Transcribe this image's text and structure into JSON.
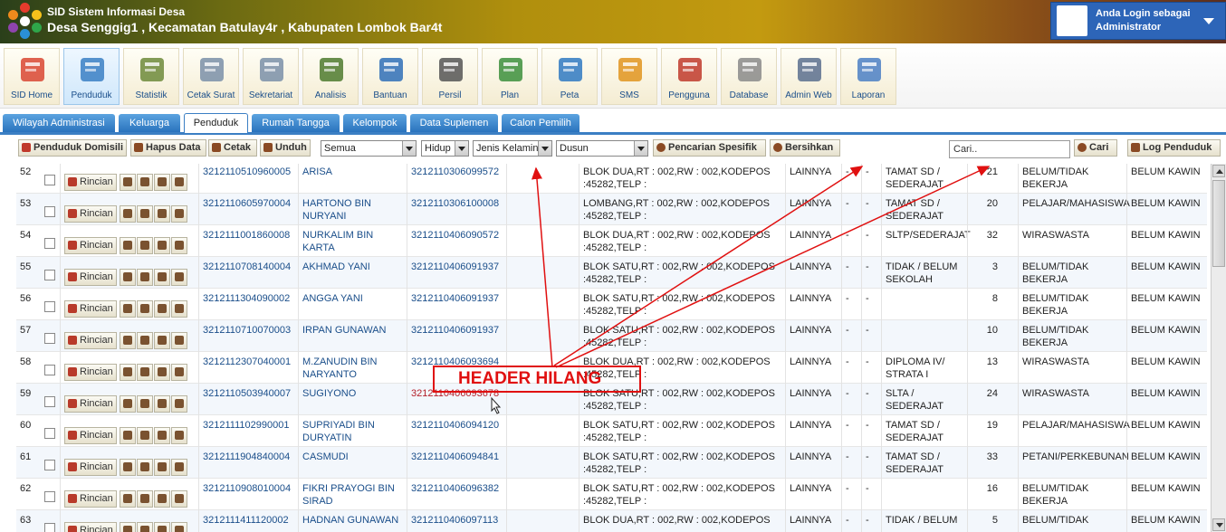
{
  "header": {
    "app_title": "SID Sistem Informasi Desa",
    "village_title": "Desa Senggig1 , Kecamatan Batulay4r , Kabupaten Lombok Bar4t",
    "user_line1": "Anda Login sebagai",
    "user_line2": "Administrator"
  },
  "menu": [
    {
      "label": "SID Home",
      "icon": "house-icon"
    },
    {
      "label": "Penduduk",
      "icon": "people-icon"
    },
    {
      "label": "Statistik",
      "icon": "bar-chart-icon"
    },
    {
      "label": "Cetak Surat",
      "icon": "document-icon"
    },
    {
      "label": "Sekretariat",
      "icon": "document-icon"
    },
    {
      "label": "Analisis",
      "icon": "binders-icon"
    },
    {
      "label": "Bantuan",
      "icon": "help-book-icon"
    },
    {
      "label": "Persil",
      "icon": "map-icon"
    },
    {
      "label": "Plan",
      "icon": "globe-search-icon"
    },
    {
      "label": "Peta",
      "icon": "globe-icon"
    },
    {
      "label": "SMS",
      "icon": "sms-icon"
    },
    {
      "label": "Pengguna",
      "icon": "users-icon"
    },
    {
      "label": "Database",
      "icon": "database-icon"
    },
    {
      "label": "Admin Web",
      "icon": "admin-web-icon"
    },
    {
      "label": "Laporan",
      "icon": "mail-icon"
    }
  ],
  "tabs": [
    "Wilayah Administrasi",
    "Keluarga",
    "Penduduk",
    "Rumah Tangga",
    "Kelompok",
    "Data Suplemen",
    "Calon Pemilih"
  ],
  "toolbar": {
    "domisili": "Penduduk Domisili",
    "hapus": "Hapus Data",
    "cetak": "Cetak",
    "unduh": "Unduh",
    "filter_status": "Semua",
    "filter_hidup": "Hidup",
    "filter_kelamin": "Jenis Kelamin",
    "filter_dusun": "Dusun",
    "spesifik": "Pencarian Spesifik",
    "bersihkan": "Bersihkan",
    "search_value": "Cari..",
    "cari": "Cari",
    "log": "Log Penduduk",
    "rincian": "Rincian"
  },
  "rows": [
    {
      "no": "52",
      "nik": "3212110510960005",
      "nama": [
        "ARISA",
        ""
      ],
      "kk": "3212110306099572",
      "alamat": [
        "BLOK DUA,RT : 002,RW : 002,KODEPOS",
        ":45282,TELP :"
      ],
      "jk": "LAINNYA",
      "a": "-",
      "b": "-",
      "pend": [
        "TAMAT SD /",
        "SEDERAJAT"
      ],
      "umur": "21",
      "kerja": [
        "BELUM/TIDAK",
        "BEKERJA"
      ],
      "kawin": "BELUM KAWIN"
    },
    {
      "no": "53",
      "nik": "3212110605970004",
      "nama": [
        "HARTONO BIN",
        "NURYANI"
      ],
      "kk": "3212110306100008",
      "alamat": [
        "LOMBANG,RT : 002,RW : 002,KODEPOS",
        ":45282,TELP :"
      ],
      "jk": "LAINNYA",
      "a": "-",
      "b": "-",
      "pend": [
        "TAMAT SD /",
        "SEDERAJAT"
      ],
      "umur": "20",
      "kerja": [
        "PELAJAR/MAHASISWA",
        ""
      ],
      "kawin": "BELUM KAWIN"
    },
    {
      "no": "54",
      "nik": "3212111001860008",
      "nama": [
        "NURKALIM BIN KARTA",
        ""
      ],
      "kk": "3212110406090572",
      "alamat": [
        "BLOK DUA,RT : 002,RW : 002,KODEPOS",
        ":45282,TELP :"
      ],
      "jk": "LAINNYA",
      "a": "-",
      "b": "-",
      "pend": [
        "SLTP/SEDERAJAT",
        ""
      ],
      "umur": "32",
      "kerja": [
        "WIRASWASTA",
        ""
      ],
      "kawin": "BELUM KAWIN"
    },
    {
      "no": "55",
      "nik": "3212110708140004",
      "nama": [
        "AKHMAD YANI",
        ""
      ],
      "kk": "3212110406091937",
      "alamat": [
        "BLOK SATU,RT : 002,RW : 002,KODEPOS",
        ":45282,TELP :"
      ],
      "jk": "LAINNYA",
      "a": "-",
      "b": "-",
      "pend": [
        "TIDAK / BELUM",
        "SEKOLAH"
      ],
      "umur": "3",
      "kerja": [
        "BELUM/TIDAK",
        "BEKERJA"
      ],
      "kawin": "BELUM KAWIN"
    },
    {
      "no": "56",
      "nik": "3212111304090002",
      "nama": [
        "ANGGA YANI",
        ""
      ],
      "kk": "3212110406091937",
      "alamat": [
        "BLOK SATU,RT : 002,RW : 002,KODEPOS",
        ":45282,TELP :"
      ],
      "jk": "LAINNYA",
      "a": "-",
      "b": "-",
      "pend": [
        "",
        ""
      ],
      "umur": "8",
      "kerja": [
        "BELUM/TIDAK",
        "BEKERJA"
      ],
      "kawin": "BELUM KAWIN"
    },
    {
      "no": "57",
      "nik": "3212110710070003",
      "nama": [
        "IRPAN GUNAWAN",
        ""
      ],
      "kk": "3212110406091937",
      "alamat": [
        "BLOK SATU,RT : 002,RW : 002,KODEPOS",
        ":45282,TELP :"
      ],
      "jk": "LAINNYA",
      "a": "-",
      "b": "-",
      "pend": [
        "",
        ""
      ],
      "umur": "10",
      "kerja": [
        "BELUM/TIDAK",
        "BEKERJA"
      ],
      "kawin": "BELUM KAWIN"
    },
    {
      "no": "58",
      "nik": "3212112307040001",
      "nama": [
        "M.ZANUDIN BIN",
        "NARYANTO"
      ],
      "kk": "3212110406093694",
      "alamat": [
        "BLOK DUA,RT : 002,RW : 002,KODEPOS",
        ":45282,TELP :"
      ],
      "jk": "LAINNYA",
      "a": "-",
      "b": "-",
      "pend": [
        "DIPLOMA IV/",
        "STRATA I"
      ],
      "umur": "13",
      "kerja": [
        "WIRASWASTA",
        ""
      ],
      "kawin": "BELUM KAWIN"
    },
    {
      "no": "59",
      "nik": "3212110503940007",
      "nama": [
        "SUGIYONO",
        ""
      ],
      "kk": "3212110406093678",
      "alamat": [
        "BLOK SATU,RT : 002,RW : 002,KODEPOS",
        ":45282,TELP :"
      ],
      "jk": "LAINNYA",
      "a": "-",
      "b": "-",
      "pend": [
        "SLTA /",
        "SEDERAJAT"
      ],
      "umur": "24",
      "kerja": [
        "WIRASWASTA",
        ""
      ],
      "kawin": "BELUM KAWIN"
    },
    {
      "no": "60",
      "nik": "3212111102990001",
      "nama": [
        "SUPRIYADI BIN",
        "DURYATIN"
      ],
      "kk": "3212110406094120",
      "alamat": [
        "BLOK SATU,RT : 002,RW : 002,KODEPOS",
        ":45282,TELP :"
      ],
      "jk": "LAINNYA",
      "a": "-",
      "b": "-",
      "pend": [
        "TAMAT SD /",
        "SEDERAJAT"
      ],
      "umur": "19",
      "kerja": [
        "PELAJAR/MAHASISWA",
        ""
      ],
      "kawin": "BELUM KAWIN"
    },
    {
      "no": "61",
      "nik": "3212111904840004",
      "nama": [
        "CASMUDI",
        ""
      ],
      "kk": "3212110406094841",
      "alamat": [
        "BLOK SATU,RT : 002,RW : 002,KODEPOS",
        ":45282,TELP :"
      ],
      "jk": "LAINNYA",
      "a": "-",
      "b": "-",
      "pend": [
        "TAMAT SD /",
        "SEDERAJAT"
      ],
      "umur": "33",
      "kerja": [
        "PETANI/PERKEBUNAN",
        ""
      ],
      "kawin": "BELUM KAWIN"
    },
    {
      "no": "62",
      "nik": "3212110908010004",
      "nama": [
        "FIKRI PRAYOGI BIN",
        "SIRAD"
      ],
      "kk": "3212110406096382",
      "alamat": [
        "BLOK SATU,RT : 002,RW : 002,KODEPOS",
        ":45282,TELP :"
      ],
      "jk": "LAINNYA",
      "a": "-",
      "b": "-",
      "pend": [
        "",
        ""
      ],
      "umur": "16",
      "kerja": [
        "BELUM/TIDAK",
        "BEKERJA"
      ],
      "kawin": "BELUM KAWIN"
    },
    {
      "no": "63",
      "nik": "3212111411120002",
      "nama": [
        "HADNAN GUNAWAN",
        ""
      ],
      "kk": "3212110406097113",
      "alamat": [
        "BLOK DUA,RT : 002,RW : 002,KODEPOS",
        ""
      ],
      "jk": "LAINNYA",
      "a": "-",
      "b": "-",
      "pend": [
        "TIDAK / BELUM",
        ""
      ],
      "umur": "5",
      "kerja": [
        "BELUM/TIDAK",
        ""
      ],
      "kawin": "BELUM KAWIN"
    }
  ],
  "annotation": "HEADER HILANG",
  "colors": {
    "link": "#1a4e8a",
    "tab": "#2a73bd",
    "annotation": "#e01010"
  }
}
